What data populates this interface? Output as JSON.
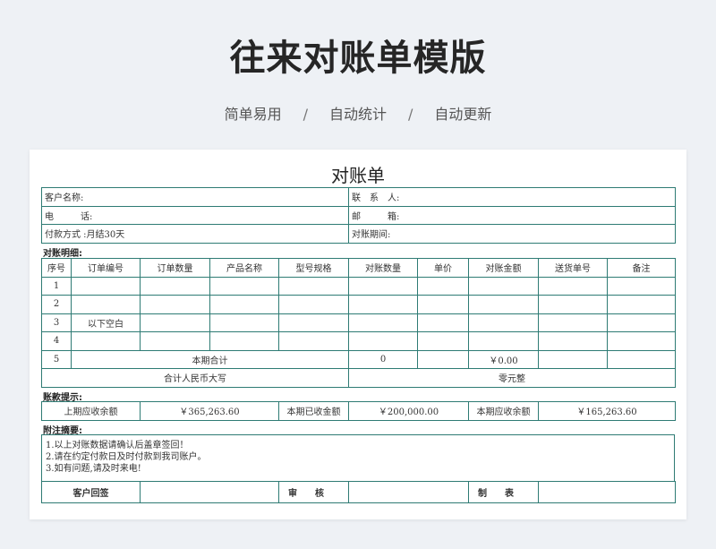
{
  "page": {
    "title": "往来对账单模版",
    "subtitle": [
      "简单易用",
      "自动统计",
      "自动更新"
    ],
    "separator": "/"
  },
  "doc": {
    "title": "对账单",
    "info": {
      "customer_name": "客户名称:",
      "contact": "联　系　人:",
      "phone": "电　　　话:",
      "email": "邮　　　箱:",
      "payment": "付款方式 :月结30天",
      "period": "对账期间:"
    },
    "detail_section": "对账明细:",
    "headers": [
      "序号",
      "订单编号",
      "订单数量",
      "产品名称",
      "型号规格",
      "对账数量",
      "单价",
      "对账金额",
      "送货单号",
      "备注"
    ],
    "rows": [
      {
        "no": "1",
        "note": ""
      },
      {
        "no": "2",
        "note": ""
      },
      {
        "no": "3",
        "note": "以下空白"
      },
      {
        "no": "4",
        "note": ""
      }
    ],
    "subtotal": {
      "no": "5",
      "label": "本期合计",
      "qty": "0",
      "amount": "￥0.00"
    },
    "total_cn": {
      "label": "合计人民币大写",
      "value": "零元整"
    },
    "payment_section": "账款提示:",
    "payment": {
      "prev_label": "上期应收余额",
      "prev_value": "￥365,263.60",
      "received_label": "本期已收金额",
      "received_value": "￥200,000.00",
      "current_label": "本期应收余额",
      "current_value": "￥165,263.60"
    },
    "notes_section": "附注摘要:",
    "notes": [
      "1.以上对账数据请确认后盖章签回！",
      "2.请在约定付款日及时付款到我司账户。",
      "3.如有问题,请及时来电!"
    ],
    "sign": {
      "customer": "客户回签",
      "review": "审　　核",
      "prepare": "制　　表"
    }
  }
}
